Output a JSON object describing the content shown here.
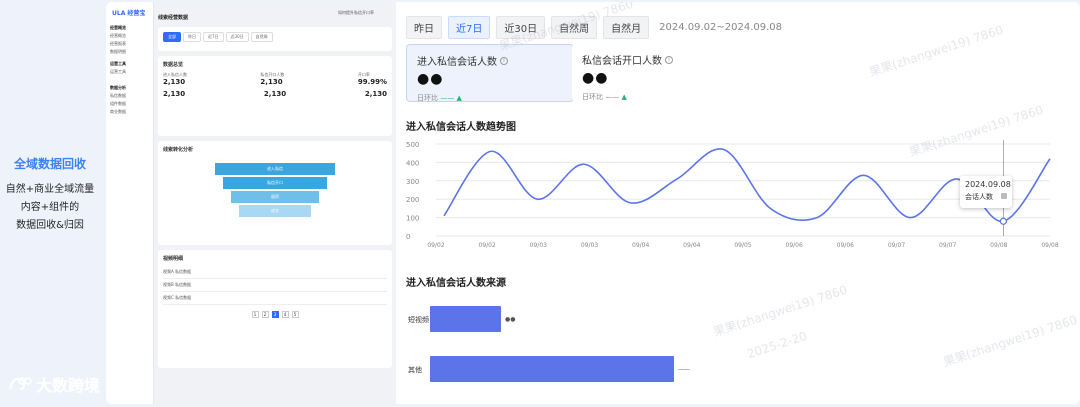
{
  "promo": {
    "title": "全域数据回收",
    "lines": [
      "自然+商业全域流量",
      "内容+组件的",
      "数据回收&归因"
    ],
    "brand": "大数跨境"
  },
  "app": {
    "logo": "ULA 经营宝",
    "sidebar_groups": [
      {
        "title": "经营概览",
        "items": [
          "经营概览",
          "经营报表",
          "数据明细"
        ]
      },
      {
        "title": "运营工具",
        "items": [
          "运营工具"
        ]
      },
      {
        "title": "数据分析",
        "items": [
          "私信数据",
          "组件数据",
          "商业数据"
        ]
      }
    ],
    "inner_title": "线索经营数据",
    "help_link": "如何提升私信开口率",
    "mini_tabs": [
      "全部",
      "昨日",
      "近7日",
      "近30日",
      "自然周"
    ],
    "overview_title": "数据总览",
    "kpis": [
      {
        "label": "进入私信人数",
        "value": "2,130"
      },
      {
        "label": "私信开口人数",
        "value": "2,130"
      },
      {
        "label": "开口率",
        "value": "99.99%"
      }
    ],
    "funnel_title": "线索转化分析",
    "funnel": [
      "进入私信",
      "私信开口",
      "留资",
      "成交"
    ],
    "detail_title": "视频明细",
    "table_rows": [
      "视频A 私信数据",
      "视频B 私信数据",
      "视频C 私信数据"
    ],
    "pages": [
      "1",
      "2",
      "3",
      "4",
      "5"
    ]
  },
  "filters": {
    "tabs": [
      "昨日",
      "近7日",
      "近30日",
      "自然周",
      "自然月"
    ],
    "active": "近7日",
    "date_range": "2024.09.02~2024.09.08"
  },
  "metrics": [
    {
      "label": "进入私信会话人数",
      "value": "●●",
      "compare_label": "日环比",
      "compare_value": "—— ▲"
    },
    {
      "label": "私信会话开口人数",
      "value": "●●",
      "compare_label": "日环比",
      "compare_value": "—— ▲"
    }
  ],
  "trend": {
    "title": "进入私信会话人数趋势图",
    "tooltip_date": "2024.09.08",
    "tooltip_series": "会话人数"
  },
  "source": {
    "title": "进入私信会话人数来源",
    "bars": [
      {
        "label": "短视频",
        "value": 0.29,
        "value_text": "●●"
      },
      {
        "label": "其他",
        "value": 1.0,
        "value_text": "—— "
      }
    ]
  },
  "watermark": "果果(zhangwei19) 7860",
  "watermark_date": "2025-2-20",
  "colors": {
    "accent": "#2f6bff",
    "line": "#5b74e9",
    "bar": "#5b74e9",
    "promo": "#3b82f6"
  },
  "chart_data": {
    "type": "line",
    "x": [
      "09/02",
      "09/02",
      "09/03",
      "09/03",
      "09/04",
      "09/04",
      "09/05",
      "09/06",
      "09/06",
      "09/07",
      "09/07",
      "09/08",
      "09/08"
    ],
    "series": [
      {
        "values": [
          110,
          460,
          200,
          390,
          180,
          310,
          470,
          150,
          100,
          330,
          100,
          310,
          80,
          420
        ]
      }
    ],
    "ylim": [
      0,
      500
    ],
    "yticks": [
      0,
      100,
      200,
      300,
      400,
      500
    ],
    "grid": true,
    "xlabel": "",
    "ylabel": ""
  }
}
